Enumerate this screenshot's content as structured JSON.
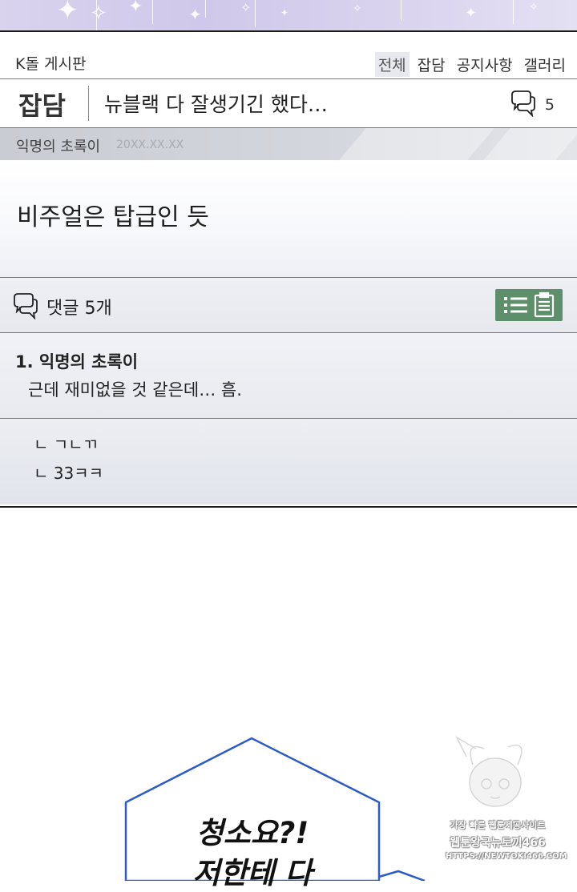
{
  "board": {
    "name": "K돌 게시판",
    "tabs": [
      {
        "label": "전체",
        "active": true
      },
      {
        "label": "잡담",
        "active": false
      },
      {
        "label": "공지사항",
        "active": false
      },
      {
        "label": "갤러리",
        "active": false
      }
    ]
  },
  "post": {
    "category": "잡담",
    "title": "뉴블랙 다 잘생기긴 했다…",
    "comment_count": "5",
    "author": "익명의 초록이",
    "date": "20XX.XX.XX",
    "body": "비주얼은 탑급인 듯"
  },
  "comments_bar": {
    "label": "댓글 5개",
    "accent_color": "#5e8f6b"
  },
  "comments": [
    {
      "author": "1. 익명의 초록이",
      "text": "근데 재미없을 것 같은데… 흠."
    }
  ],
  "replies": [
    "ㄴ ㄱㄴㄲ",
    "ㄴ 33ㅋㅋ"
  ],
  "speech_bubble": {
    "line1": "청소요?!",
    "line2": "저한테 다"
  },
  "watermark": {
    "line1": "가장 빠른 웹툰제공사이트",
    "line2": "웹툰왕국뉴토끼466",
    "line3": "HTTPS://NEWTOKI466.COM"
  },
  "icons": [
    "speech-bubbles-icon",
    "list-icon",
    "clipboard-icon"
  ]
}
